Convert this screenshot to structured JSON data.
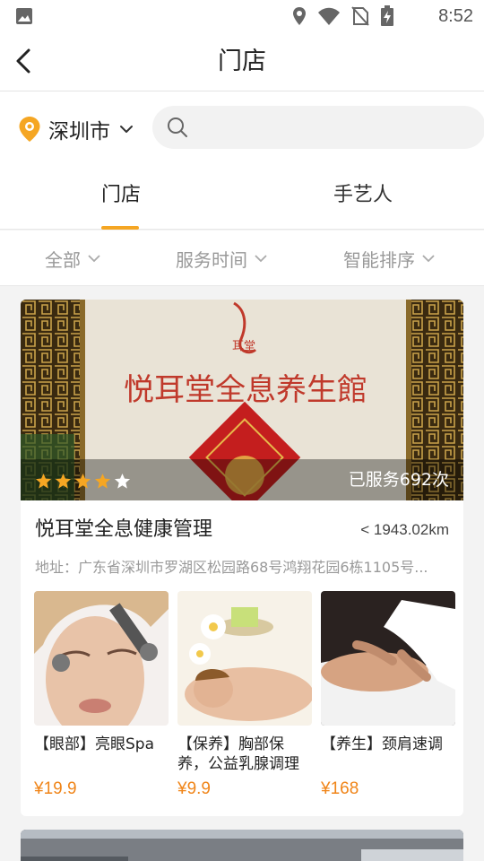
{
  "status": {
    "time": "8:52"
  },
  "nav": {
    "title": "门店"
  },
  "location": {
    "city": "深圳市"
  },
  "search": {
    "placeholder": ""
  },
  "tabs": [
    {
      "label": "门店",
      "active": true
    },
    {
      "label": "手艺人",
      "active": false
    }
  ],
  "filters": [
    {
      "label": "全部"
    },
    {
      "label": "服务时间"
    },
    {
      "label": "智能排序"
    }
  ],
  "shop": {
    "name": "悦耳堂全息健康管理",
    "distance": "< 1943.02km",
    "address": "地址：广东省深圳市罗湖区松园路68号鸿翔花园6栋1105号...",
    "served": "已服务692次",
    "rating": 4,
    "rating_max": 5,
    "banner_text": "悦耳堂全息养生館",
    "banner_logo": "耳堂",
    "services": [
      {
        "title": "【眼部】亮眼Spa",
        "price": "¥19.9"
      },
      {
        "title": "【保养】胸部保养，公益乳腺调理",
        "price": "¥9.9"
      },
      {
        "title": "【养生】颈肩速调",
        "price": "¥168"
      }
    ]
  },
  "colors": {
    "accent": "#f5a623",
    "price": "#f08519",
    "star": "#f5a623"
  }
}
